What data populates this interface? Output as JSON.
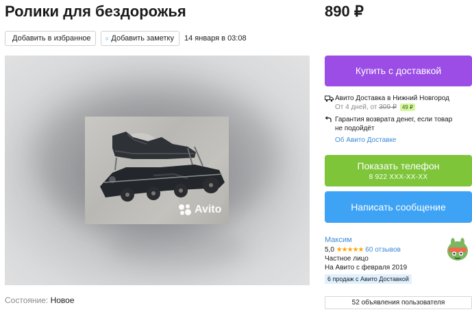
{
  "listing": {
    "title": "Ролики для бездорожья",
    "price": "890 ₽",
    "date": "14 января в 03:08",
    "condition_label": "Состояние:",
    "condition_value": "Новое"
  },
  "actions": {
    "favorite": "Добавить в избранное",
    "note": "Добавить заметку"
  },
  "gallery": {
    "watermark": "Avito"
  },
  "buy": {
    "label": "Купить с доставкой"
  },
  "delivery": {
    "title": "Авито Доставка в Нижний Новгород",
    "eta": "От 4 дней, от",
    "old_price": "309 ₽",
    "new_price": "49 ₽",
    "guarantee_line1": "Гарантия возврата денег, если товар",
    "guarantee_line2": "не подойдёт",
    "link": "Об Авито Доставке"
  },
  "phone": {
    "label": "Показать телефон",
    "number": "8 922 XXX-XX-XX"
  },
  "message": {
    "label": "Написать сообщение"
  },
  "seller": {
    "name": "Максим",
    "rating": "5,0",
    "stars": "★★★★★",
    "reviews": "60 отзывов",
    "type": "Частное лицо",
    "since": "На Авито с февраля 2019",
    "sales": "6 продаж с Авито Доставкой"
  },
  "ads": {
    "label": "52 объявления пользователя"
  },
  "colors": {
    "buy": "#9b4de6",
    "phone": "#7ec53a",
    "message": "#3ea3f5",
    "link": "#3d8ad6",
    "stars": "#ffa500"
  }
}
